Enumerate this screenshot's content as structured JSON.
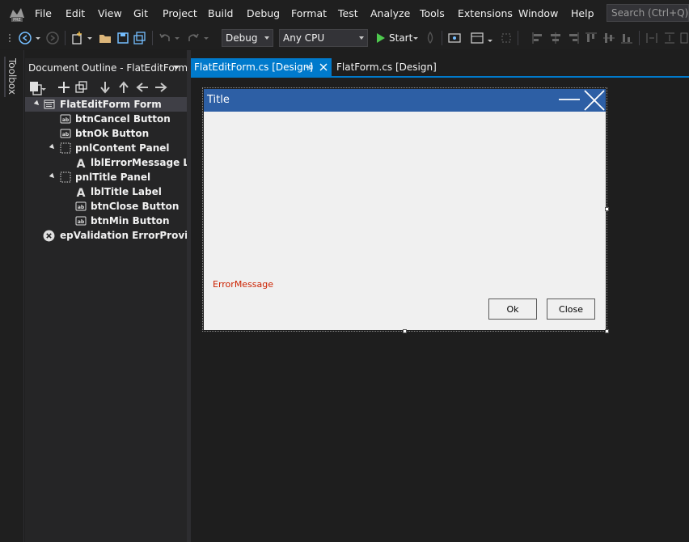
{
  "menu": {
    "items": [
      "File",
      "Edit",
      "View",
      "Git",
      "Project",
      "Build",
      "Debug",
      "Format",
      "Test",
      "Analyze",
      "Tools",
      "Extensions",
      "Window",
      "Help"
    ],
    "search_placeholder": "Search (Ctrl+Q)"
  },
  "toolbar": {
    "config": "Debug",
    "platform": "Any CPU",
    "start_label": "Start"
  },
  "toolbox": {
    "label": "Toolbox"
  },
  "outline": {
    "title": "Document Outline - FlatEditForm",
    "tree": [
      {
        "label": "FlatEditForm  Form",
        "icon": "form-icon",
        "expanded": true,
        "selected": true
      },
      {
        "label": "btnCancel  Button",
        "icon": "button-icon"
      },
      {
        "label": "btnOk  Button",
        "icon": "button-icon"
      },
      {
        "label": "pnlContent  Panel",
        "icon": "panel-icon",
        "expanded": true
      },
      {
        "label": "lblErrorMessage  Label",
        "icon": "label-icon"
      },
      {
        "label": "pnlTitle  Panel",
        "icon": "panel-icon",
        "expanded": true
      },
      {
        "label": "lblTitle  Label",
        "icon": "label-icon"
      },
      {
        "label": "btnClose  Button",
        "icon": "button-icon"
      },
      {
        "label": "btnMin  Button",
        "icon": "button-icon"
      },
      {
        "label": "epValidation  ErrorProvider",
        "icon": "error-provider-icon"
      }
    ]
  },
  "tabs": [
    {
      "label": "FlatEditForm.cs [Design]",
      "active": true
    },
    {
      "label": "FlatForm.cs [Design]",
      "active": false
    }
  ],
  "form": {
    "title": "Title",
    "error_message": "ErrorMessage",
    "ok_label": "Ok",
    "close_label": "Close"
  },
  "colors": {
    "accent": "#007acc",
    "form_title_bar": "#2d5fa5",
    "error_text": "#cc2200"
  }
}
